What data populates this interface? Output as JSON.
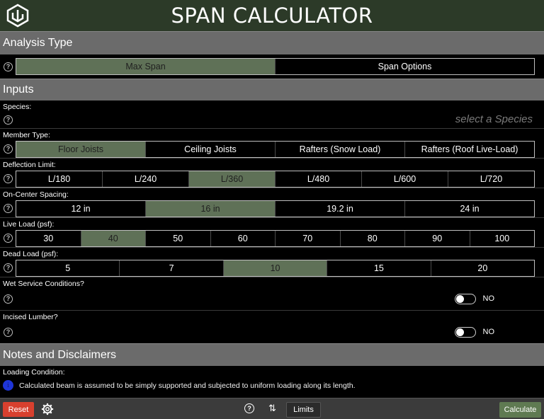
{
  "header": {
    "title": "SPAN CALCULATOR"
  },
  "analysis": {
    "heading": "Analysis Type",
    "options": [
      "Max Span",
      "Span Options"
    ],
    "selected": 0
  },
  "inputs": {
    "heading": "Inputs",
    "species": {
      "label": "Species:",
      "placeholder": "select a Species"
    },
    "member_type": {
      "label": "Member Type:",
      "options": [
        "Floor Joists",
        "Ceiling Joists",
        "Rafters (Snow Load)",
        "Rafters (Roof Live-Load)"
      ],
      "selected": 0
    },
    "deflection": {
      "label": "Deflection Limit:",
      "options": [
        "L/180",
        "L/240",
        "L/360",
        "L/480",
        "L/600",
        "L/720"
      ],
      "selected": 2
    },
    "spacing": {
      "label": "On-Center Spacing:",
      "options": [
        "12 in",
        "16 in",
        "19.2 in",
        "24 in"
      ],
      "selected": 1
    },
    "live_load": {
      "label": "Live Load (psf):",
      "options": [
        "30",
        "40",
        "50",
        "60",
        "70",
        "80",
        "90",
        "100"
      ],
      "selected": 1
    },
    "dead_load": {
      "label": "Dead Load (psf):",
      "options": [
        "5",
        "7",
        "10",
        "15",
        "20"
      ],
      "selected": 2
    },
    "wet_service": {
      "label": "Wet Service Conditions?",
      "value": "NO"
    },
    "incised": {
      "label": "Incised Lumber?",
      "value": "NO"
    }
  },
  "notes": {
    "heading": "Notes and Disclaimers",
    "loading_label": "Loading Condition:",
    "loading_text": "Calculated beam is assumed to be simply supported and subjected to uniform loading along its length."
  },
  "footer": {
    "reset": "Reset",
    "limits": "Limits",
    "calculate": "Calculate"
  },
  "colors": {
    "header": "#2c3a28",
    "selected": "#5f7157",
    "reset": "#d8402e",
    "calculate": "#5f7a52",
    "info": "#1e35d8"
  }
}
